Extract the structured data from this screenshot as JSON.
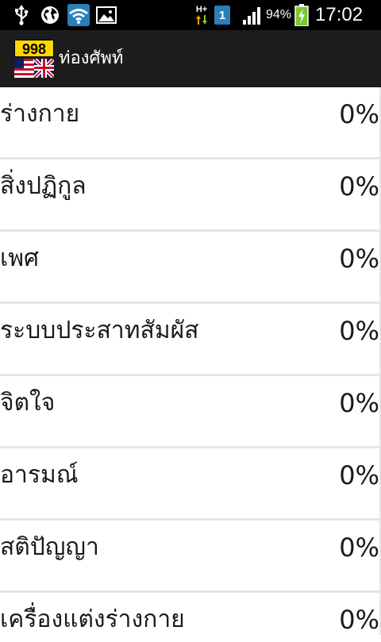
{
  "status_bar": {
    "network_type": "H+",
    "sim_slot": "1",
    "battery_percent": "94%",
    "time": "17:02",
    "icons": [
      "usb-icon",
      "globe-icon",
      "wifi-icon",
      "image-icon",
      "data-arrows-icon",
      "signal-icon",
      "battery-charging-icon"
    ]
  },
  "app_bar": {
    "logo_number": "998",
    "title": "ท่องศัพท์"
  },
  "categories": [
    {
      "label": "ร่างกาย",
      "progress": "0%"
    },
    {
      "label": "สิ่งปฏิกูล",
      "progress": "0%"
    },
    {
      "label": "เพศ",
      "progress": "0%"
    },
    {
      "label": "ระบบประสาทสัมผัส",
      "progress": "0%"
    },
    {
      "label": "จิตใจ",
      "progress": "0%"
    },
    {
      "label": "อารมณ์",
      "progress": "0%"
    },
    {
      "label": "สติปัญญา",
      "progress": "0%"
    },
    {
      "label": "เครื่องแต่งร่างกาย",
      "progress": "0%"
    }
  ],
  "colors": {
    "status_bar_bg": "#000000",
    "app_bar_bg": "#1c1c1c",
    "logo_yellow": "#ffd800",
    "wifi_blue": "#33b5e5",
    "battery_green": "#7cc832"
  }
}
